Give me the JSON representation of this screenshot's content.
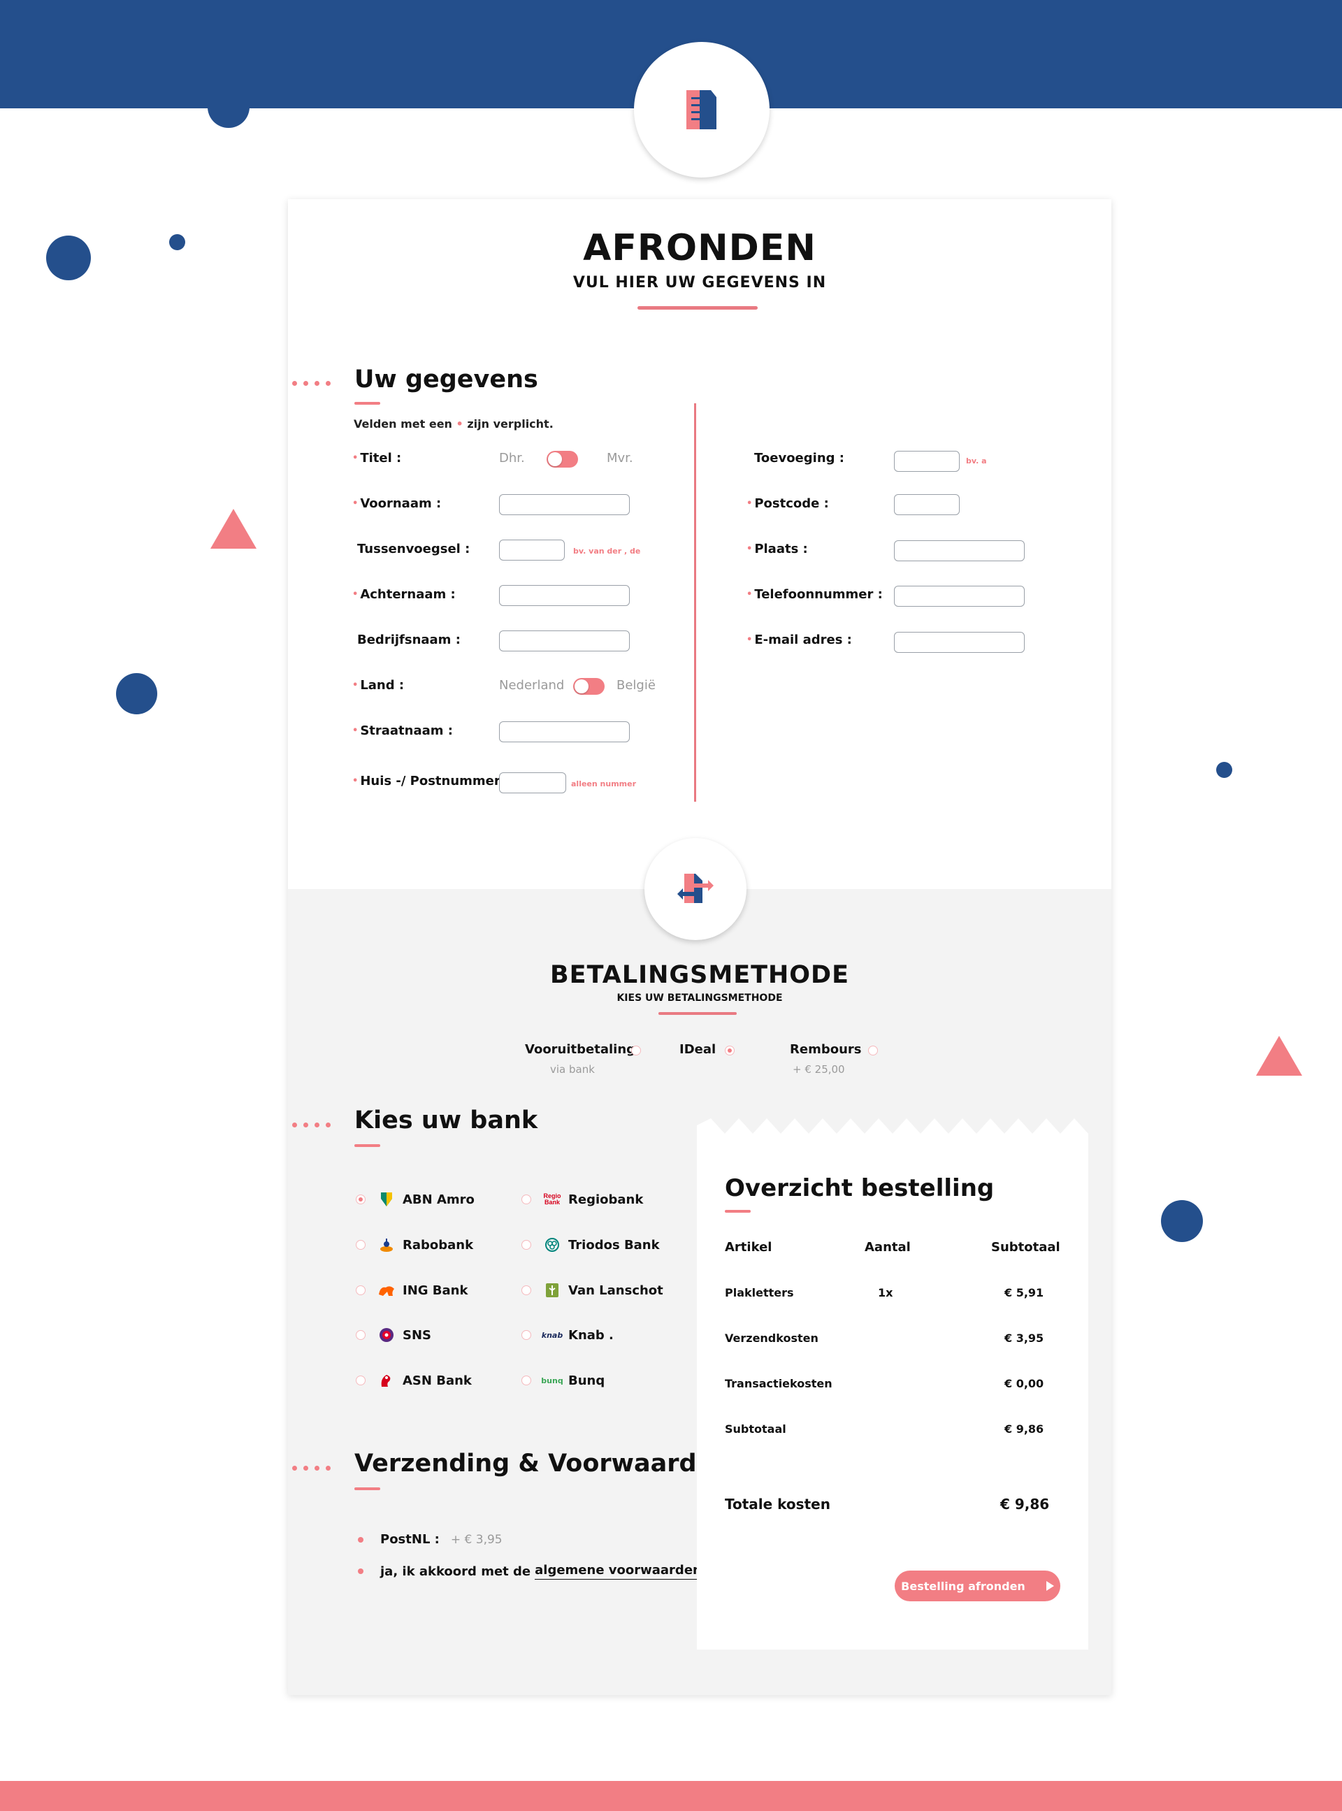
{
  "header": {
    "title": "AFRONDEN",
    "subtitle": "VUL HIER UW GEGEVENS IN",
    "logo_icon": "document-icon"
  },
  "personal": {
    "section_title": "Uw gegevens",
    "required_note_prefix": "Velden met een",
    "required_note_suffix": "zijn verplicht.",
    "fields": {
      "titel": {
        "label": "Titel :",
        "option_left": "Dhr.",
        "option_right": "Mvr."
      },
      "voornaam": {
        "label": "Voornaam :",
        "value": ""
      },
      "tussenvoegsel": {
        "label": "Tussenvoegsel :",
        "value": "",
        "hint": "bv. van der , de"
      },
      "achternaam": {
        "label": "Achternaam :",
        "value": ""
      },
      "bedrijfsnaam": {
        "label": "Bedrijfsnaam :",
        "value": ""
      },
      "land": {
        "label": "Land :",
        "option_left": "Nederland",
        "option_right": "België"
      },
      "straatnaam": {
        "label": "Straatnaam :",
        "value": ""
      },
      "huisnummer": {
        "label": "Huis -/ Postnummer :",
        "value": "",
        "hint": "alleen nummer"
      },
      "toevoeging": {
        "label": "Toevoeging :",
        "value": "",
        "hint": "bv. a"
      },
      "postcode": {
        "label": "Postcode :",
        "value": ""
      },
      "plaats": {
        "label": "Plaats :",
        "value": ""
      },
      "telefoon": {
        "label": "Telefoonnummer :",
        "value": ""
      },
      "email": {
        "label": "E-mail adres :",
        "value": ""
      }
    }
  },
  "payment": {
    "title": "BETALINGSMETHODE",
    "subtitle": "KIES UW BETALINGSMETHODE",
    "icon": "payment-exchange-icon",
    "methods": [
      {
        "label": "Vooruitbetaling",
        "sub": "via bank",
        "selected": false
      },
      {
        "label": "IDeal",
        "sub": "",
        "selected": true
      },
      {
        "label": "Rembours",
        "sub": "+ € 25,00",
        "selected": false
      }
    ]
  },
  "banks": {
    "section_title": "Kies uw bank",
    "items": [
      {
        "name": "ABN Amro",
        "icon": "abn-amro-logo-icon",
        "selected": true
      },
      {
        "name": "Rabobank",
        "icon": "rabobank-logo-icon",
        "selected": false
      },
      {
        "name": "ING Bank",
        "icon": "ing-lion-logo-icon",
        "selected": false
      },
      {
        "name": "SNS",
        "icon": "sns-logo-icon",
        "selected": false
      },
      {
        "name": "ASN Bank",
        "icon": "asn-logo-icon",
        "selected": false
      },
      {
        "name": "Regiobank",
        "icon": "regiobank-logo-icon",
        "logo_text": "Regio Bank",
        "selected": false
      },
      {
        "name": "Triodos Bank",
        "icon": "triodos-logo-icon",
        "selected": false
      },
      {
        "name": "Van Lanschot",
        "icon": "van-lanschot-logo-icon",
        "selected": false
      },
      {
        "name": "Knab .",
        "icon": "knab-logo-icon",
        "logo_text": "knab",
        "selected": false
      },
      {
        "name": "Bunq",
        "icon": "bunq-logo-icon",
        "logo_text": "bunq",
        "selected": false
      }
    ]
  },
  "shipping": {
    "section_title": "Verzending & Voorwaarden",
    "carrier_label": "PostNL :",
    "carrier_price": "+ € 3,95",
    "agree_prefix": "ja, ik akkoord met de",
    "agree_link": "algemene voorwaarden."
  },
  "overview": {
    "title": "Overzicht bestelling",
    "columns": [
      "Artikel",
      "Aantal",
      "Subtotaal"
    ],
    "rows": [
      {
        "article": "Plakletters",
        "qty": "1x",
        "subtotal": "€ 5,91"
      },
      {
        "article": "Verzendkosten",
        "qty": "",
        "subtotal": "€ 3,95"
      },
      {
        "article": "Transactiekosten",
        "qty": "",
        "subtotal": "€ 0,00"
      },
      {
        "article": "Subtotaal",
        "qty": "",
        "subtotal": "€ 9,86"
      }
    ],
    "total_label": "Totale kosten",
    "total_value": "€ 9,86",
    "submit_label": "Bestelling afronden"
  },
  "colors": {
    "primary_blue": "#244f8c",
    "accent_pink": "#f27e84",
    "panel_gray": "#f3f3f3"
  }
}
